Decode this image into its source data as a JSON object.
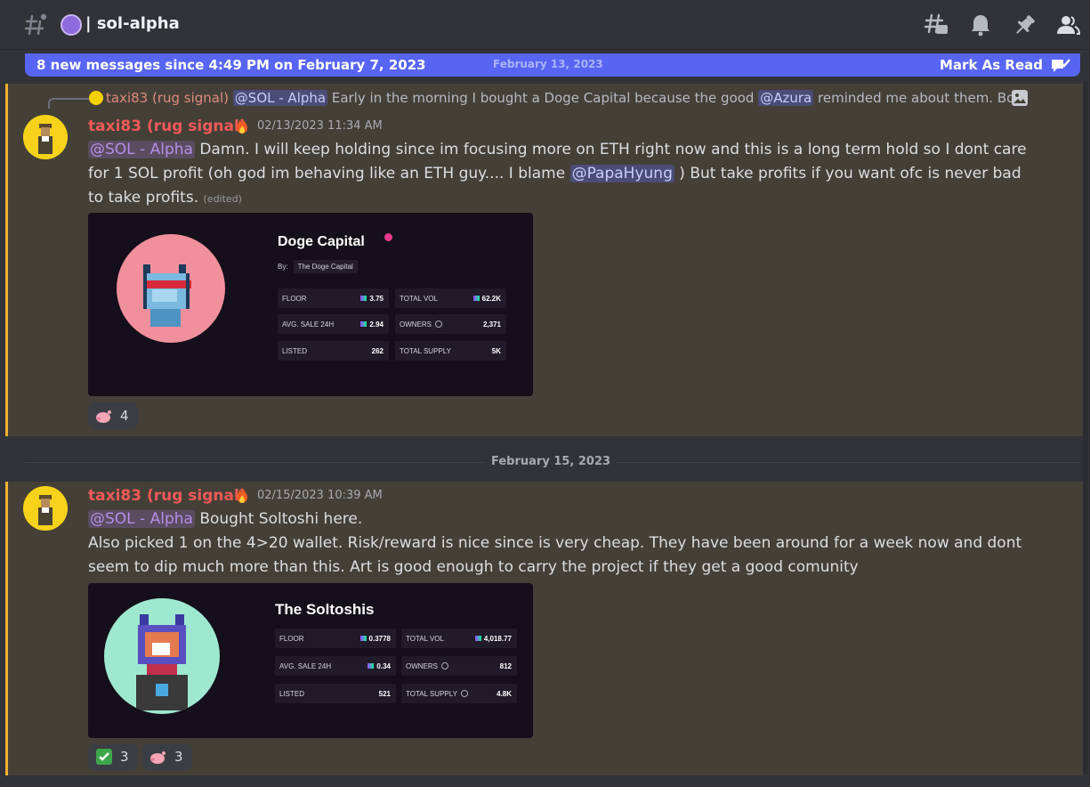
{
  "header": {
    "channel_name": "sol-alpha",
    "status_color": "#8e6bdc",
    "icons": [
      "threads-icon",
      "bell-icon",
      "pin-icon",
      "members-icon"
    ]
  },
  "banner": {
    "text": "8 new messages since 4:49 PM on February 7, 2023",
    "faint_date": "February 13, 2023",
    "mark_read": "Mark As Read",
    "color": "#5865f2"
  },
  "messages": [
    {
      "reply": {
        "author": "taxi83 (rug signal)",
        "mention": "@SOL - Alpha",
        "text_a": "Early in the morning I bought a Doge Capital because the good",
        "mention2": "@Azura",
        "text_b": "reminded me about them. Bo"
      },
      "author": "taxi83 (rug signal)",
      "timestamp": "02/13/2023 11:34 AM",
      "role_mention": "@SOL - Alpha",
      "text_1": "Damn. I will keep holding since im focusing more on ETH right now and this is a long term hold so I dont care for 1 SOL profit (oh god im behaving like an ETH guy.... I blame",
      "mention": "@PapaHyung",
      "text_2": ") But take profits if you want ofc is never bad to take profits.",
      "edited": "(edited)",
      "embed": {
        "title": "Doge Capital",
        "by_label": "By:",
        "by_name": "The Doge Capital",
        "stats": [
          {
            "label": "FLOOR",
            "value": "3.75",
            "sol": true
          },
          {
            "label": "TOTAL VOL",
            "value": "62.2K",
            "sol": true
          },
          {
            "label": "AVG. SALE 24H",
            "value": "2.94",
            "sol": true
          },
          {
            "label": "OWNERS",
            "value": "2,371",
            "info": true
          },
          {
            "label": "LISTED",
            "value": "262"
          },
          {
            "label": "TOTAL SUPPLY",
            "value": "5K"
          }
        ]
      },
      "reactions": [
        {
          "emoji": "pig-emoji",
          "count": "4"
        }
      ]
    },
    {
      "author": "taxi83 (rug signal)",
      "timestamp": "02/15/2023 10:39 AM",
      "role_mention": "@SOL - Alpha",
      "text_1": "Bought Soltoshi  here.",
      "text_2": "Also picked 1 on the 4>20 wallet. Risk/reward is nice since is very cheap. They have been around for a week now and dont seem to dip much more than this. Art is good enough to carry the project if they get a good comunity",
      "embed": {
        "title": "The Soltoshis",
        "stats": [
          {
            "label": "FLOOR",
            "value": "0.3778",
            "sol": true
          },
          {
            "label": "TOTAL VOL",
            "value": "4,018.77",
            "sol": true
          },
          {
            "label": "AVG. SALE 24H",
            "value": "0.34",
            "sol": true
          },
          {
            "label": "OWNERS",
            "value": "812",
            "info": true
          },
          {
            "label": "LISTED",
            "value": "521"
          },
          {
            "label": "TOTAL SUPPLY",
            "value": "4.8K",
            "info": true
          }
        ]
      },
      "reactions": [
        {
          "emoji": "check-emoji",
          "count": "3"
        },
        {
          "emoji": "pig-emoji",
          "count": "3"
        }
      ]
    }
  ],
  "divider_date": "February 15, 2023"
}
